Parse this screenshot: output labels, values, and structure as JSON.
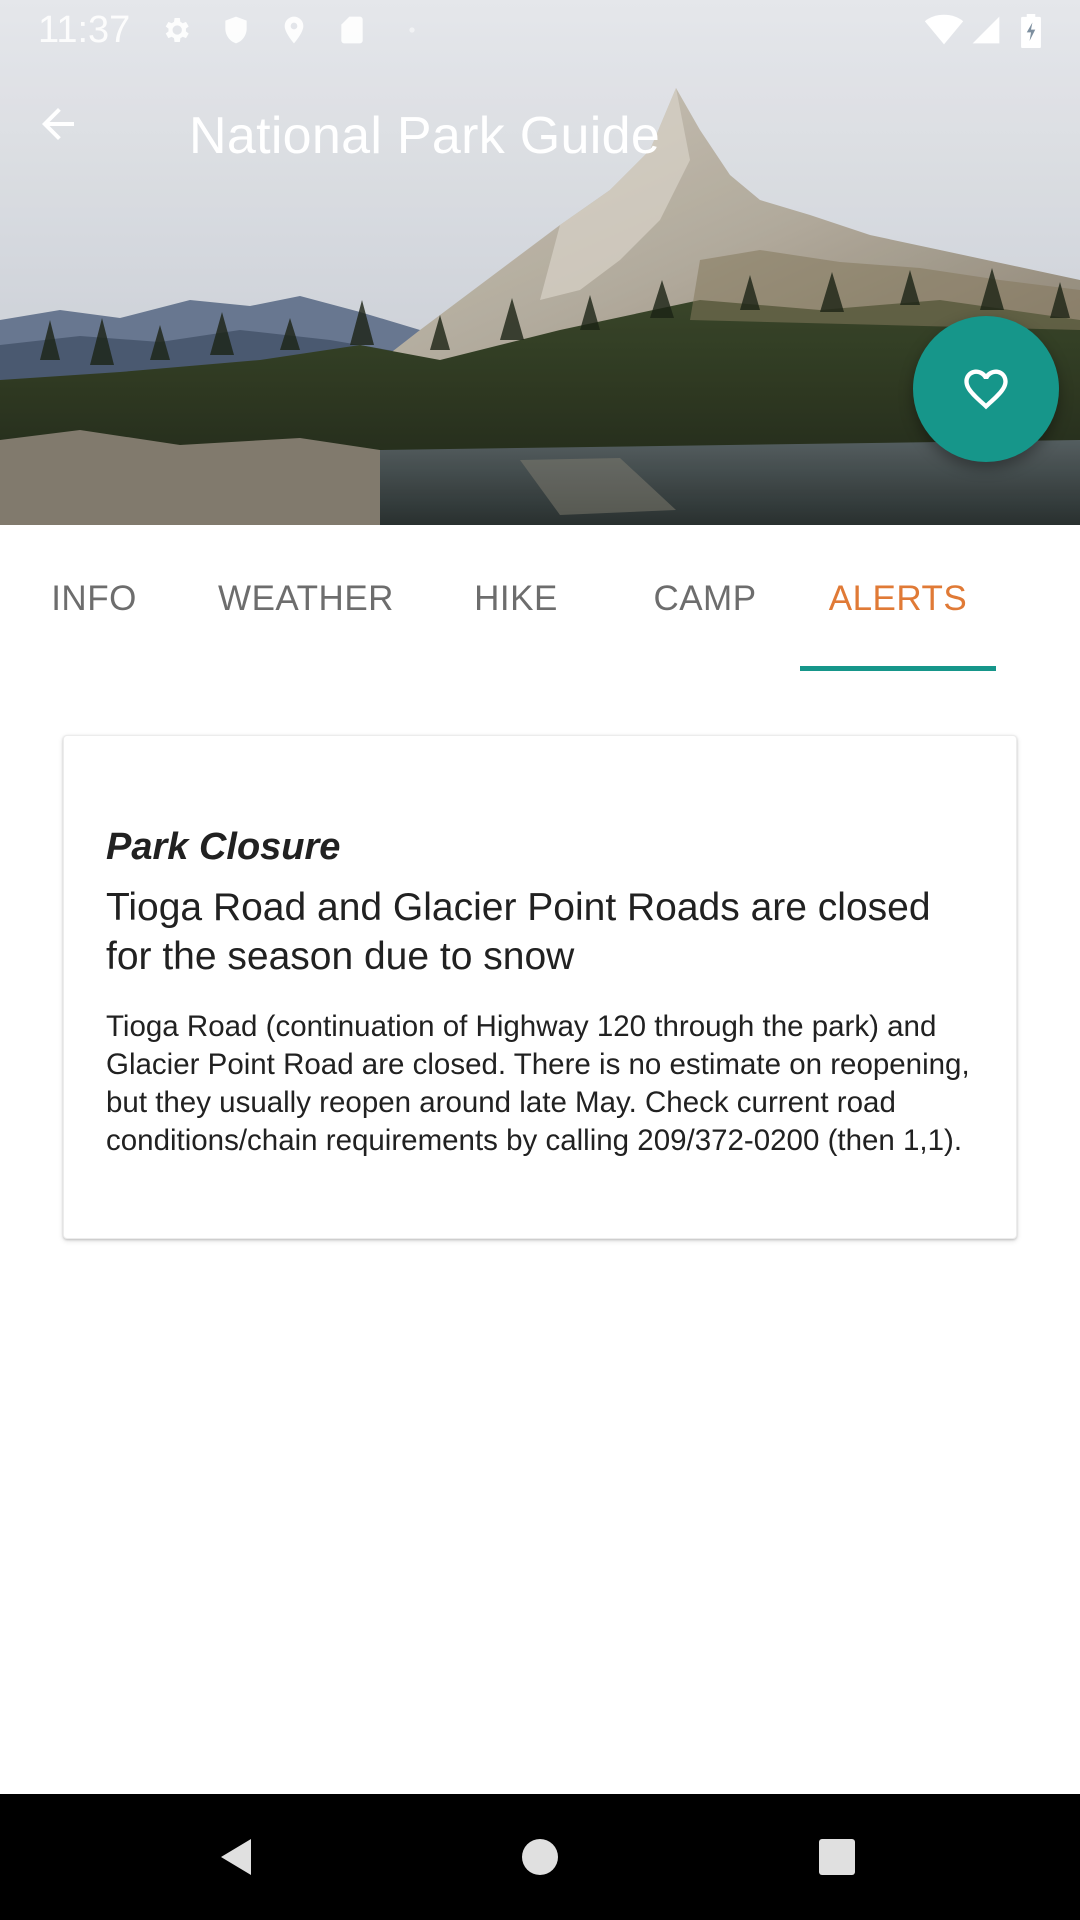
{
  "status_bar": {
    "time": "11:37",
    "icons": [
      "gear-icon",
      "shield-icon",
      "location-pin-icon",
      "sd-card-icon",
      "wifi-icon",
      "cell-signal-icon",
      "battery-icon"
    ]
  },
  "app_bar": {
    "title": "National Park Guide",
    "back_icon": "arrow-back-icon",
    "favorite_icon": "heart-outline-icon"
  },
  "colors": {
    "accent": "#16968a",
    "active_tab": "#e07a36",
    "inactive_tab": "#6d6d6d",
    "text": "#212121"
  },
  "tabs": [
    {
      "label": "INFO",
      "active": false
    },
    {
      "label": "WEATHER",
      "active": false
    },
    {
      "label": "HIKE",
      "active": false
    },
    {
      "label": "CAMP",
      "active": false
    },
    {
      "label": "ALERTS",
      "active": true
    }
  ],
  "alert": {
    "type": "Park Closure",
    "title": "Tioga Road and Glacier Point Roads are closed for the season due to snow",
    "body": "Tioga Road (continuation of Highway 120 through the park) and Glacier Point Road are closed. There is no estimate on reopening, but they usually reopen around late May. Check current road conditions/chain requirements by calling 209/372-0200 (then 1,1)."
  },
  "nav_bar": {
    "buttons": [
      "back-triangle-icon",
      "home-circle-icon",
      "recents-square-icon"
    ]
  }
}
